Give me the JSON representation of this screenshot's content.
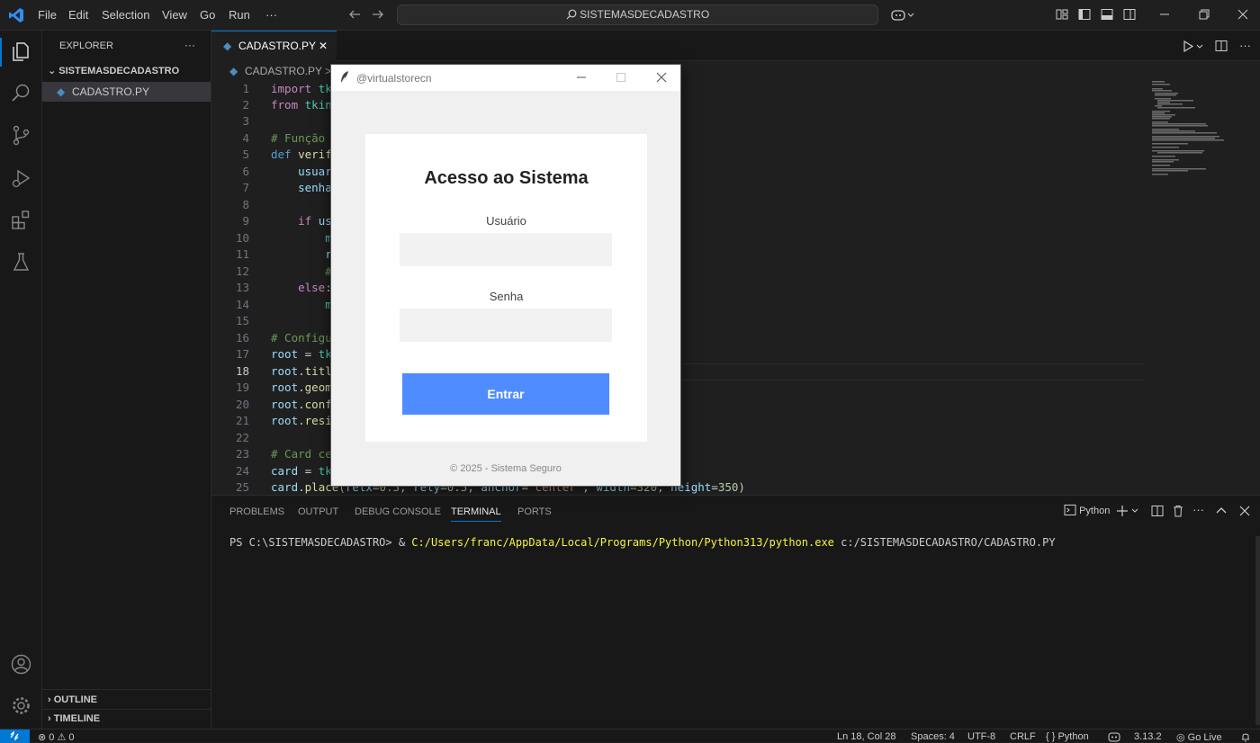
{
  "titlebar": {
    "menus": [
      "File",
      "Edit",
      "Selection",
      "View",
      "Go",
      "Run",
      "···"
    ],
    "search_text": "SISTEMASDECADASTRO"
  },
  "sidebar": {
    "title": "EXPLORER",
    "more": "···",
    "folder": "SISTEMASDECADASTRO",
    "file": "CADASTRO.PY",
    "outline": "OUTLINE",
    "timeline": "TIMELINE"
  },
  "editor": {
    "tab_label": "CADASTRO.PY",
    "tab_close": "✕",
    "breadcrumb": "CADASTRO.PY",
    "breadcrumb_sep": ">",
    "line_numbers": [
      "1",
      "2",
      "3",
      "4",
      "5",
      "6",
      "7",
      "8",
      "9",
      "10",
      "11",
      "12",
      "13",
      "14",
      "15",
      "16",
      "17",
      "18",
      "19",
      "20",
      "21",
      "22",
      "23",
      "24",
      "25"
    ],
    "current_line": 18
  },
  "panel": {
    "tabs": [
      "PROBLEMS",
      "OUTPUT",
      "DEBUG CONSOLE",
      "TERMINAL",
      "PORTS"
    ],
    "active_tab": "TERMINAL",
    "terminal_profile": "Python",
    "prompt": "PS C:\\SISTEMASDECADASTRO> & ",
    "command_path": "C:/Users/franc/AppData/Local/Programs/Python/Python313/python.exe",
    "command_arg": " c:/SISTEMASDECADASTRO/CADASTRO.PY"
  },
  "statusbar": {
    "problems": "⊗ 0 ⚠ 0",
    "position": "Ln 18, Col 28",
    "spaces": "Spaces: 4",
    "encoding": "UTF-8",
    "eol": "CRLF",
    "language": "{ } Python",
    "python_version": "3.13.2",
    "golive": "Go Live"
  },
  "tk_window": {
    "title": "@virtualstorecn",
    "heading": "Acesso ao Sistema",
    "user_label": "Usuário",
    "password_label": "Senha",
    "button_label": "Entrar",
    "footer": "© 2025 - Sistema Seguro"
  },
  "colors": {
    "accent": "#0078d4",
    "button": "#4f8cff"
  }
}
